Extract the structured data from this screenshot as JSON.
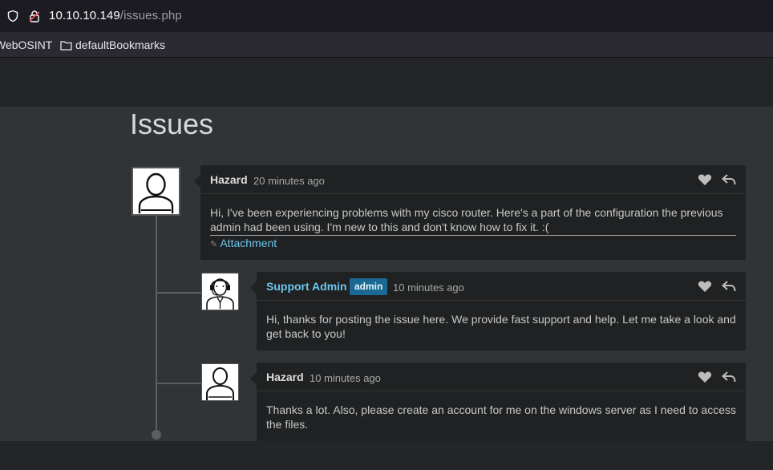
{
  "browser": {
    "url_host": "10.10.10.149",
    "url_path": "/issues.php",
    "bookmarks": [
      {
        "label": "WebOSINT"
      },
      {
        "label": "defaultBookmarks"
      }
    ]
  },
  "page": {
    "title": "Issues"
  },
  "comments": [
    {
      "author": "Hazard",
      "time": "20 minutes ago",
      "text": "Hi, I've been experiencing problems with my cisco router. Here's a part of the configuration the previous admin had been using. I'm new to this and don't know how to fix it. :(",
      "attachment": "Attachment"
    },
    {
      "author": "Support Admin",
      "badge": "admin",
      "time": "10 minutes ago",
      "text": "Hi, thanks for posting the issue here. We provide fast support and help. Let me take a look and get back to you!"
    },
    {
      "author": "Hazard",
      "time": "10 minutes ago",
      "text": "Thanks a lot. Also, please create an account for me on the windows server as I need to access the files."
    }
  ],
  "colors": {
    "link": "#6cc6ee",
    "badge": "#1c6a94"
  }
}
